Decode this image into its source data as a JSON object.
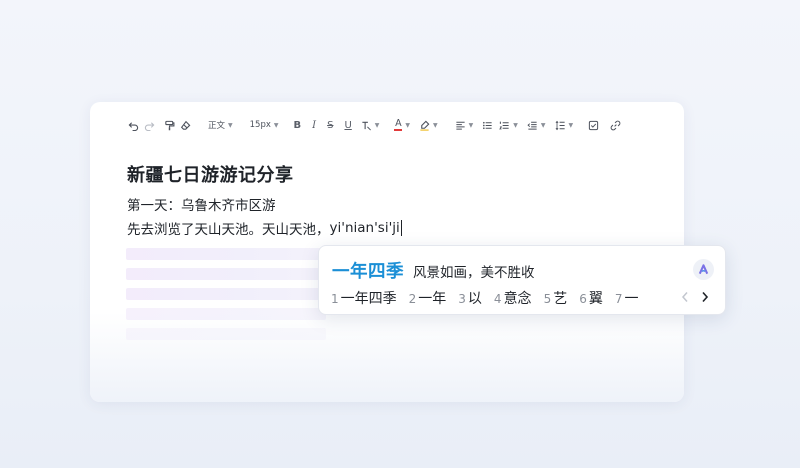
{
  "toolbar": {
    "font_style": "正文",
    "font_size": "15px",
    "bold": "B",
    "italic": "I",
    "strike": "S",
    "underline": "U",
    "font_color": "A"
  },
  "document": {
    "title": "新疆七日游游记分享",
    "line1": "第一天：乌鲁木齐市区游",
    "line2_prefix": "先去浏览了天山天池。天山天池，",
    "composition": "yi'nian'si'ji"
  },
  "ime": {
    "preedit": "一年四季",
    "association": "风景如画，美不胜收",
    "candidates": [
      {
        "num": "1",
        "word": "一年四季"
      },
      {
        "num": "2",
        "word": "一年"
      },
      {
        "num": "3",
        "word": "以"
      },
      {
        "num": "4",
        "word": "意念"
      },
      {
        "num": "5",
        "word": "艺"
      },
      {
        "num": "6",
        "word": "翼"
      },
      {
        "num": "7",
        "word": "一"
      }
    ]
  },
  "colors": {
    "accent": "#1b8fd6",
    "text": "#1f2329",
    "skeleton": "#f3ecfb"
  }
}
